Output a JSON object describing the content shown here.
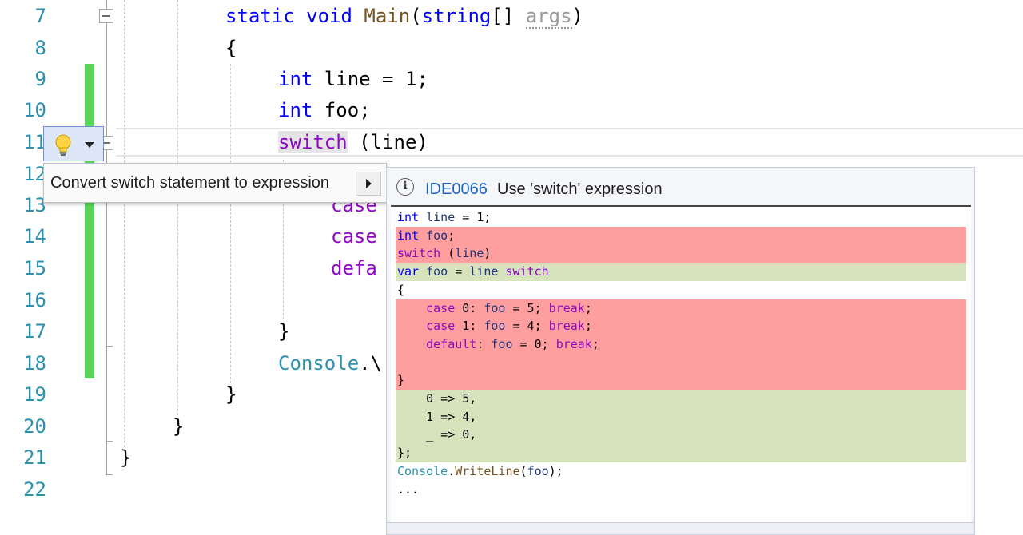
{
  "editor": {
    "line_numbers": [
      "7",
      "8",
      "9",
      "10",
      "11",
      "12",
      "13",
      "14",
      "15",
      "16",
      "17",
      "18",
      "19",
      "20",
      "21",
      "22"
    ]
  },
  "code": {
    "l7": {
      "kw_static": "static",
      "kw_void": "void",
      "fn": "Main",
      "open": "(",
      "kw_string": "string",
      "brackets": "[] ",
      "param": "args",
      "close": ")"
    },
    "l8": "{",
    "l9": {
      "kw": "int",
      "rest": " line = 1;"
    },
    "l10": {
      "kw": "int",
      "rest": " foo;"
    },
    "l11": {
      "kw": "switch",
      "rest": " (line)"
    },
    "l13": "case",
    "l14": "case",
    "l15": "defa",
    "l17": "}",
    "l18": {
      "type": "Console",
      "dot": ".\\"
    },
    "l19": "}",
    "l20": "}",
    "l21": "}"
  },
  "lightbulb": {
    "icon": "lightbulb-icon",
    "dropdown_icon": "chevron-down-icon"
  },
  "menu": {
    "item_label": "Convert switch statement to expression",
    "submenu_icon": "chevron-right-icon"
  },
  "preview": {
    "info_icon": "i",
    "diagnostic_id": "IDE0066",
    "message": "Use 'switch' expression",
    "lines": [
      {
        "text": "int line = 1;",
        "state": "normal"
      },
      {
        "text": "int foo;",
        "state": "deleted"
      },
      {
        "text": "switch (line)",
        "state": "deleted"
      },
      {
        "text": "var foo = line switch",
        "state": "added"
      },
      {
        "text": "{",
        "state": "normal"
      },
      {
        "text": "    case 0: foo = 5; break;",
        "state": "deleted"
      },
      {
        "text": "    case 1: foo = 4; break;",
        "state": "deleted"
      },
      {
        "text": "    default: foo = 0; break;",
        "state": "deleted"
      },
      {
        "text": "",
        "state": "deleted"
      },
      {
        "text": "}",
        "state": "deleted"
      },
      {
        "text": "    0 => 5,",
        "state": "added"
      },
      {
        "text": "    1 => 4,",
        "state": "added"
      },
      {
        "text": "    _ => 0,",
        "state": "added"
      },
      {
        "text": "};",
        "state": "added"
      },
      {
        "text": "Console.WriteLine(foo);",
        "state": "normal"
      },
      {
        "text": "...",
        "state": "normal"
      }
    ]
  },
  "colors": {
    "line_number": "#2b91af",
    "keyword": "#0000ff",
    "control_keyword": "#8f08c4",
    "change_bar": "#5ad35a",
    "diff_deleted": "#ff9e9e",
    "diff_added": "#d7e3bc",
    "diagnostic_link": "#1a66c7"
  }
}
